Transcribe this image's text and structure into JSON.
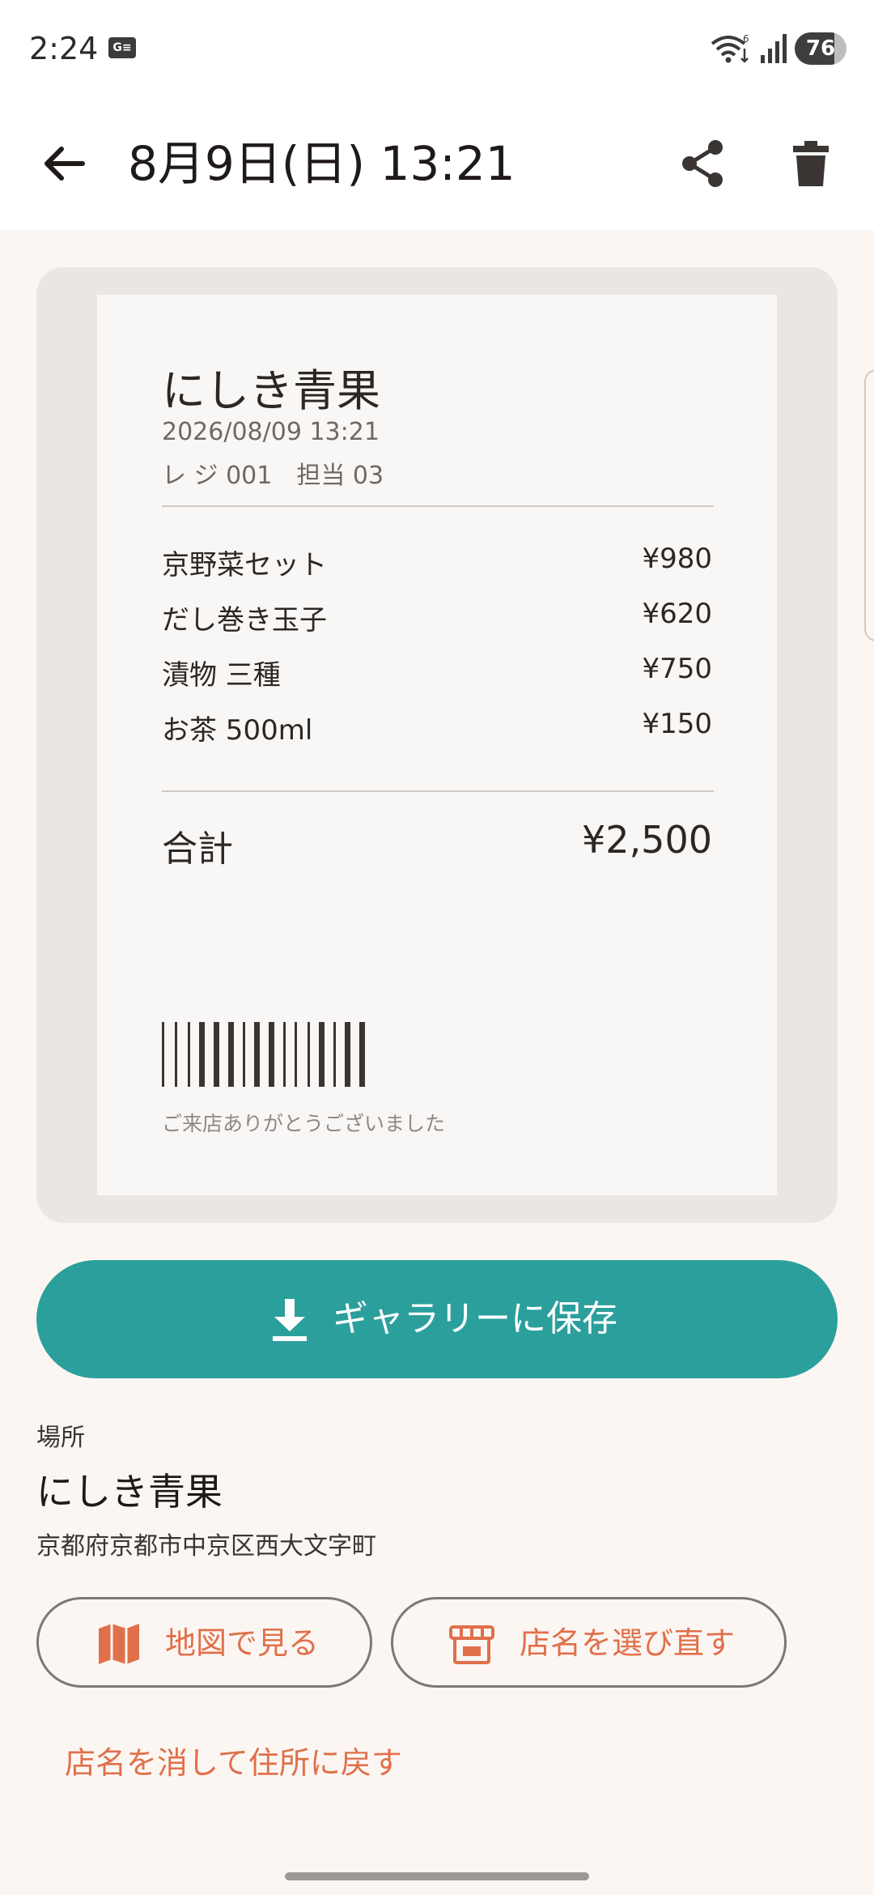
{
  "status_bar": {
    "time": "2:24",
    "notification_icon": "news-app-icon",
    "battery_percent": 76,
    "battery_label": "76"
  },
  "app_bar": {
    "title": "8月9日(日) 13:21",
    "back_icon": "arrow-left-icon",
    "share_icon": "share-icon",
    "delete_icon": "trash-icon"
  },
  "receipt": {
    "store_name": "にしき青果",
    "datetime": "2026/08/09 13:21",
    "register": "レ ジ 001　担当 03",
    "items": [
      {
        "name": "京野菜セット",
        "price": "¥980"
      },
      {
        "name": "だし巻き玉子",
        "price": "¥620"
      },
      {
        "name": "漬物 三種",
        "price": "¥750"
      },
      {
        "name": "お茶 500ml",
        "price": "¥150"
      }
    ],
    "total_label": "合計",
    "total_value": "¥2,500",
    "thanks": "ご来店ありがとうございました"
  },
  "save_button": {
    "label": "ギャラリーに保存",
    "icon": "download-icon"
  },
  "location": {
    "section_label": "場所",
    "name": "にしき青果",
    "address": "京都府京都市中京区西大文字町",
    "map_button": {
      "label": "地図で見る",
      "icon": "map-icon"
    },
    "rename_button": {
      "label": "店名を選び直す",
      "icon": "store-icon"
    },
    "clear_link": "店名を消して住所に戻す"
  },
  "colors": {
    "accent_teal": "#2b9f9c",
    "accent_orange": "#e0704a",
    "background": "#fcf6f3"
  }
}
